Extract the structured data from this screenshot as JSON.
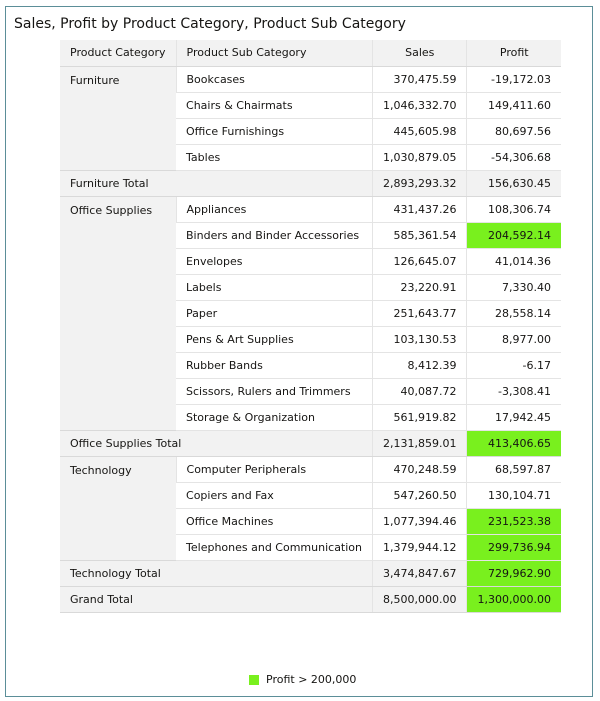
{
  "title": "Sales, Profit by Product Category, Product Sub Category",
  "columns": [
    "Product Category",
    "Product Sub Category",
    "Sales",
    "Profit"
  ],
  "highlight_color": "#79f01e",
  "groups": [
    {
      "category": "Furniture",
      "rows": [
        {
          "sub": "Bookcases",
          "sales": "370,475.59",
          "profit": "-19,172.03",
          "hl": false
        },
        {
          "sub": "Chairs & Chairmats",
          "sales": "1,046,332.70",
          "profit": "149,411.60",
          "hl": false
        },
        {
          "sub": "Office Furnishings",
          "sales": "445,605.98",
          "profit": "80,697.56",
          "hl": false
        },
        {
          "sub": "Tables",
          "sales": "1,030,879.05",
          "profit": "-54,306.68",
          "hl": false
        }
      ],
      "total": {
        "label": "Furniture Total",
        "sales": "2,893,293.32",
        "profit": "156,630.45",
        "hl": false
      }
    },
    {
      "category": "Office Supplies",
      "rows": [
        {
          "sub": "Appliances",
          "sales": "431,437.26",
          "profit": "108,306.74",
          "hl": false
        },
        {
          "sub": "Binders and Binder Accessories",
          "sales": "585,361.54",
          "profit": "204,592.14",
          "hl": true
        },
        {
          "sub": "Envelopes",
          "sales": "126,645.07",
          "profit": "41,014.36",
          "hl": false
        },
        {
          "sub": "Labels",
          "sales": "23,220.91",
          "profit": "7,330.40",
          "hl": false
        },
        {
          "sub": "Paper",
          "sales": "251,643.77",
          "profit": "28,558.14",
          "hl": false
        },
        {
          "sub": "Pens & Art Supplies",
          "sales": "103,130.53",
          "profit": "8,977.00",
          "hl": false
        },
        {
          "sub": "Rubber Bands",
          "sales": "8,412.39",
          "profit": "-6.17",
          "hl": false
        },
        {
          "sub": "Scissors, Rulers and Trimmers",
          "sales": "40,087.72",
          "profit": "-3,308.41",
          "hl": false
        },
        {
          "sub": "Storage & Organization",
          "sales": "561,919.82",
          "profit": "17,942.45",
          "hl": false
        }
      ],
      "total": {
        "label": "Office Supplies Total",
        "sales": "2,131,859.01",
        "profit": "413,406.65",
        "hl": true
      }
    },
    {
      "category": "Technology",
      "rows": [
        {
          "sub": "Computer Peripherals",
          "sales": "470,248.59",
          "profit": "68,597.87",
          "hl": false
        },
        {
          "sub": "Copiers and Fax",
          "sales": "547,260.50",
          "profit": "130,104.71",
          "hl": false
        },
        {
          "sub": "Office Machines",
          "sales": "1,077,394.46",
          "profit": "231,523.38",
          "hl": true
        },
        {
          "sub": "Telephones and Communication",
          "sales": "1,379,944.12",
          "profit": "299,736.94",
          "hl": true
        }
      ],
      "total": {
        "label": "Technology Total",
        "sales": "3,474,847.67",
        "profit": "729,962.90",
        "hl": true
      }
    }
  ],
  "grand_total": {
    "label": "Grand Total",
    "sales": "8,500,000.00",
    "profit": "1,300,000.00",
    "hl": true
  },
  "legend": {
    "label": "Profit > 200,000"
  }
}
